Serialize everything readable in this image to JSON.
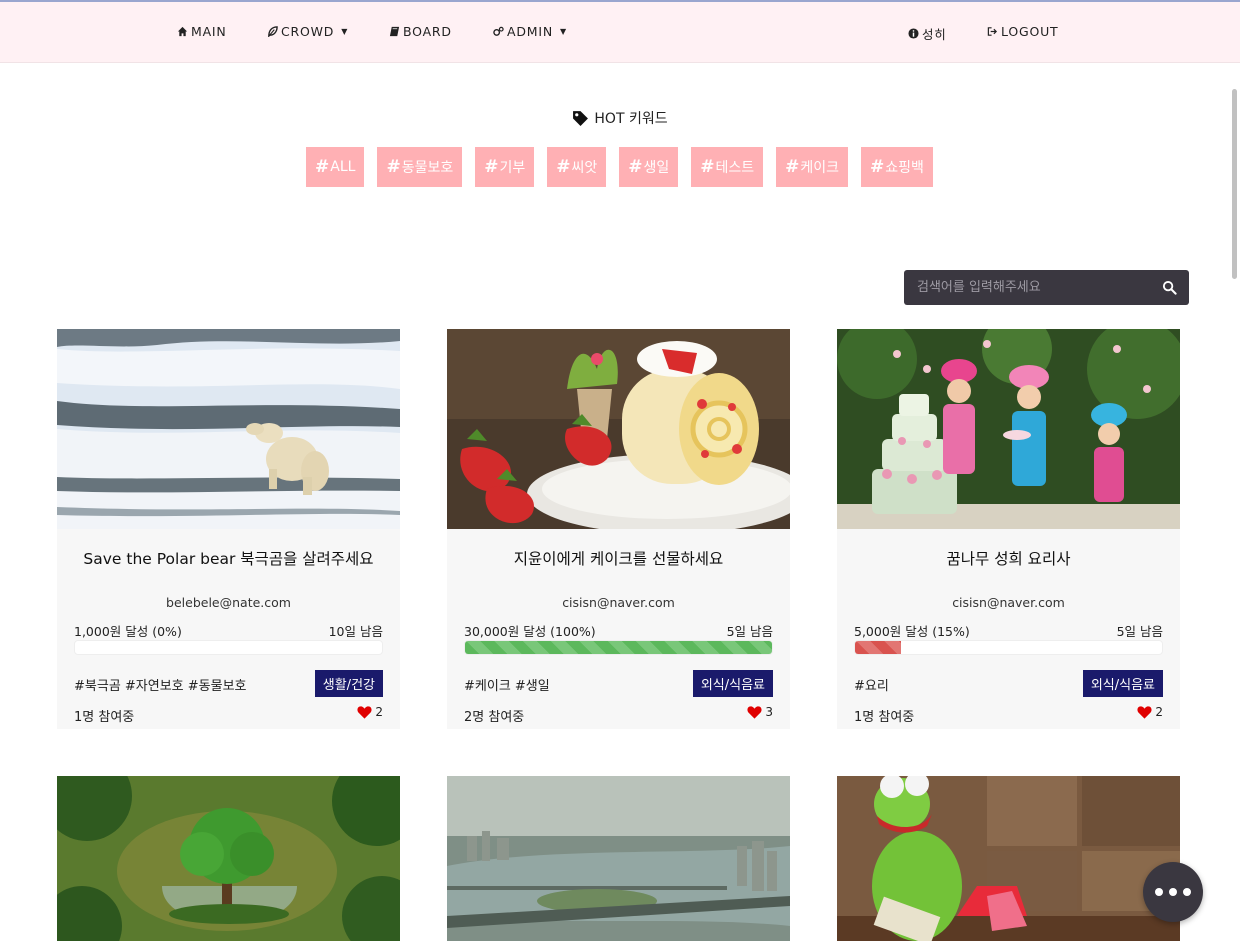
{
  "nav": {
    "main": "MAIN",
    "crowd": "CROWD",
    "board": "BOARD",
    "admin": "ADMIN",
    "user": "성히",
    "logout": "LOGOUT"
  },
  "hot": {
    "title": "HOT 키워드",
    "tags": [
      "ALL",
      "동물보호",
      "기부",
      "씨앗",
      "생일",
      "테스트",
      "케이크",
      "쇼핑백"
    ]
  },
  "search": {
    "placeholder": "검색어를 입력해주세요"
  },
  "cards": [
    {
      "title": "Save the Polar bear 북극곰을 살려주세요",
      "email": "belebele@nate.com",
      "goal": "1,000원 달성 (0%)",
      "progress": 0,
      "days": "10일 남음",
      "hashtags": "#북극곰 #자연보호 #동물보호",
      "category": "생활/건강",
      "participants": "1명 참여중",
      "likes": "2",
      "image": "polar-bear-photo"
    },
    {
      "title": "지윤이에게 케이크를 선물하세요",
      "email": "cisisn@naver.com",
      "goal": "30,000원 달성 (100%)",
      "progress": 1.0,
      "days": "5일 남음",
      "hashtags": "#케이크 #생일",
      "category": "외식/식음료",
      "participants": "2명 참여중",
      "likes": "3",
      "image": "strawberry-roll-cake-photo"
    },
    {
      "title": "꿈나무 성희 요리사",
      "email": "cisisn@naver.com",
      "goal": "5,000원 달성 (15%)",
      "progress": 0.15,
      "days": "5일 남음",
      "hashtags": "#요리",
      "category": "외식/식음료",
      "participants": "1명 참여중",
      "likes": "2",
      "image": "kids-chefs-cake-photo"
    }
  ],
  "colors": {
    "navbar_bg": "#fff1f4",
    "tag_bg": "#ffb0b4",
    "category_bg": "#1a1a6b",
    "progress_full": "#5cb85c",
    "progress_partial": "#d9534f",
    "search_bg": "#3a3740"
  }
}
